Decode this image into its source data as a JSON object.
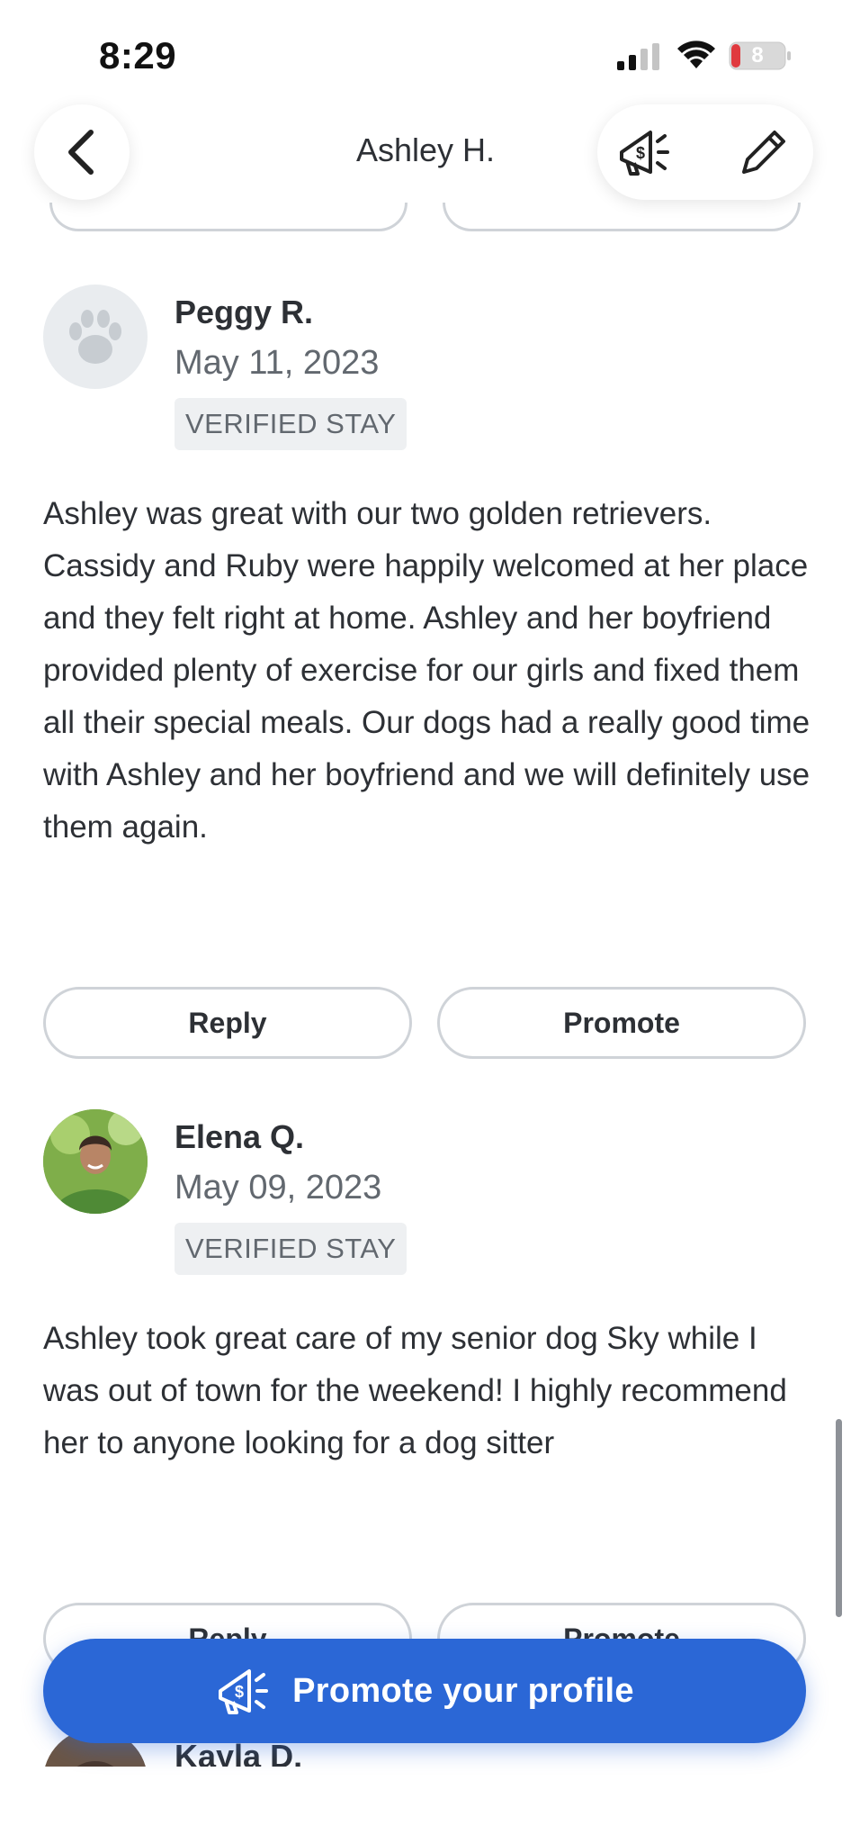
{
  "status_bar": {
    "time": "8:29",
    "battery_level": "8"
  },
  "header": {
    "title": "Ashley H.",
    "back_icon": "chevron-left-icon",
    "promote_icon": "megaphone-dollar-icon",
    "edit_icon": "pencil-icon"
  },
  "reviews": [
    {
      "name": "Peggy R.",
      "date": "May 11, 2023",
      "badge": "VERIFIED STAY",
      "avatar": "paw-placeholder",
      "text": "Ashley was great with our two golden retrievers. Cassidy and Ruby were happily welcomed at her place and they felt right at home. Ashley and her boyfriend provided plenty of exercise for our girls and fixed them all their special meals. Our dogs had a really good time with Ashley and her boyfriend and we will definitely use them again.",
      "reply_label": "Reply",
      "promote_label": "Promote"
    },
    {
      "name": "Elena Q.",
      "date": "May 09, 2023",
      "badge": "VERIFIED STAY",
      "avatar": "photo",
      "text": "Ashley took great care of my senior dog Sky while I was out of town for the weekend! I highly recommend her to anyone looking for a dog sitter",
      "reply_label": "Reply",
      "promote_label": "Promote"
    },
    {
      "name": "Kayla D.",
      "avatar": "photo"
    }
  ],
  "promote_fab": {
    "label": "Promote your profile",
    "icon": "megaphone-dollar-icon"
  },
  "colors": {
    "accent": "#2b67d6",
    "text": "#2d3035",
    "muted": "#62686f",
    "border": "#cfd3d8"
  }
}
